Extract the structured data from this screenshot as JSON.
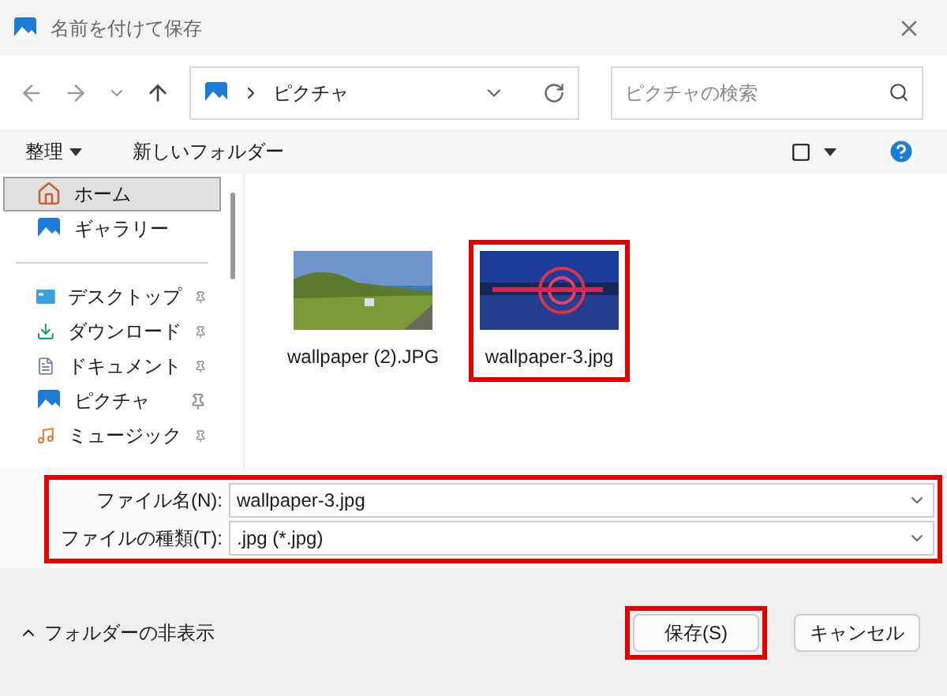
{
  "window": {
    "title": "名前を付けて保存"
  },
  "address": {
    "path": "ピクチャ"
  },
  "search": {
    "placeholder": "ピクチャの検索"
  },
  "toolbar": {
    "organize": "整理",
    "new_folder": "新しいフォルダー"
  },
  "sidebar": {
    "sections": [
      {
        "items": [
          {
            "label": "ホーム",
            "kind": "home",
            "selected": true,
            "pinned": false
          },
          {
            "label": "ギャラリー",
            "kind": "gallery",
            "selected": false,
            "pinned": false
          }
        ]
      },
      {
        "items": [
          {
            "label": "デスクトップ",
            "kind": "desktop",
            "selected": false,
            "pinned": true
          },
          {
            "label": "ダウンロード",
            "kind": "download",
            "selected": false,
            "pinned": true
          },
          {
            "label": "ドキュメント",
            "kind": "documents",
            "selected": false,
            "pinned": true
          },
          {
            "label": "ピクチャ",
            "kind": "pictures",
            "selected": false,
            "pinned": true
          },
          {
            "label": "ミュージック",
            "kind": "music",
            "selected": false,
            "pinned": true
          }
        ]
      }
    ]
  },
  "files": [
    {
      "name": "wallpaper (2).JPG",
      "kind": "landscape",
      "highlighted": false
    },
    {
      "name": "wallpaper-3.jpg",
      "kind": "night",
      "highlighted": true
    }
  ],
  "fields": {
    "highlighted": true,
    "rows": [
      {
        "label": "ファイル名(N):",
        "value": "wallpaper-3.jpg"
      },
      {
        "label": "ファイルの種類(T):",
        "value": ".jpg (*.jpg)"
      }
    ]
  },
  "footer": {
    "toggle": "フォルダーの非表示",
    "buttons": [
      {
        "label": "保存(S)",
        "highlighted": true
      },
      {
        "label": "キャンセル",
        "highlighted": false
      }
    ]
  }
}
